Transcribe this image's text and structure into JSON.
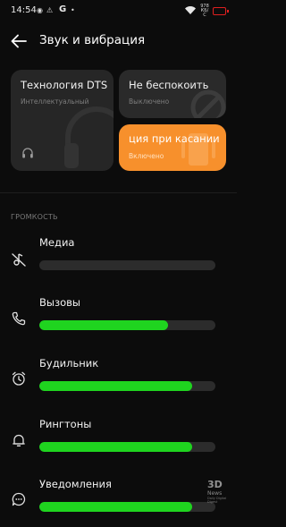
{
  "status_bar": {
    "time": "14:54",
    "indicators": [
      "◉",
      "⚠",
      "△",
      "G",
      "•"
    ],
    "network_speed": [
      "978",
      "КБ/С"
    ],
    "battery_color": "#e02020"
  },
  "header": {
    "title": "Звук и вибрация",
    "back_icon": "arrow-left-icon"
  },
  "tiles": {
    "dts": {
      "title": "Технология DTS",
      "subtitle": "Интеллектуальный",
      "icon": "headphones-icon"
    },
    "dnd": {
      "title": "Не беспокоить",
      "subtitle": "Выключено",
      "icon": "do-not-disturb-icon"
    },
    "haptic": {
      "title": "ция при касании",
      "subtitle": "Включено",
      "icon": "vibration-icon",
      "accent": "#f7902c"
    }
  },
  "volume": {
    "section_label": "ГРОМКОСТЬ",
    "fill_color": "#1fd41f",
    "items": [
      {
        "label": "Медиа",
        "icon": "music-note-muted-icon",
        "level": 0.0
      },
      {
        "label": "Вызовы",
        "icon": "phone-icon",
        "level": 0.73
      },
      {
        "label": "Будильник",
        "icon": "alarm-clock-icon",
        "level": 0.87
      },
      {
        "label": "Рингтоны",
        "icon": "bell-icon",
        "level": 0.87
      },
      {
        "label": "Уведомления",
        "icon": "chat-bubble-icon",
        "level": 0.87
      }
    ]
  },
  "watermark": {
    "brand": "3D",
    "name": "News",
    "tagline": "Daily Digital Digest"
  }
}
